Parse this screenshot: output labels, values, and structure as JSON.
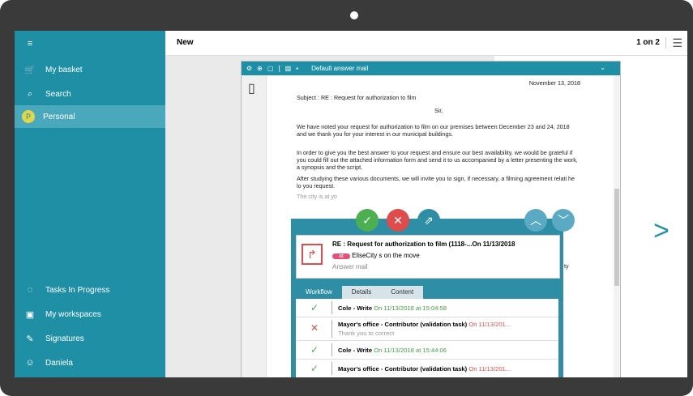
{
  "sidebar": {
    "menu_icon": "hamburger-icon",
    "top_items": [
      {
        "icon": "basket-icon",
        "label": "My basket"
      },
      {
        "icon": "search-icon",
        "label": "Search"
      },
      {
        "icon": "avatar",
        "label": "Personal",
        "avatar_letter": "P"
      }
    ],
    "bottom_items": [
      {
        "icon": "tasks-icon",
        "label": "Tasks In Progress"
      },
      {
        "icon": "workspaces-icon",
        "label": "My workspaces"
      },
      {
        "icon": "signature-icon",
        "label": "Signatures"
      },
      {
        "icon": "user-icon",
        "label": "Daniela"
      }
    ]
  },
  "topbar": {
    "title": "New",
    "pager": "1 on 2"
  },
  "document": {
    "toolbar_title": "Default answer mail",
    "date": "November 13, 2018",
    "subject": "Subject : RE : Request for authorization to film",
    "salutation": "Sir,",
    "p1": "We have noted your request for authorization to film on our premises between December 23 and 24, 2018 and we thank you for your interest in our municipal buildings.",
    "p2": "In order to give you the best answer to your request and ensure our best availability, we would be grateful if you could fill out the attached information form and send it to us accompanied by a letter presenting the work, a synopsis and the script.",
    "p3": "After studying these various documents, we will invite you to sign, if necessary, a filming agreement relati",
    "p3b": "he",
    "p3c": "lo",
    "p3d": "you request.",
    "faded": "The city is at yo",
    "right_fragments": [
      "ll",
      "ty"
    ]
  },
  "popup": {
    "mail_title": "RE : Request for authorization to film (1118-...On 11/13/2018",
    "badge": "at",
    "sender": "EliseCity s on the move",
    "mail_type": "Answer mail",
    "tabs": [
      "Workflow",
      "Details",
      "Content"
    ],
    "rows": [
      {
        "status": "done",
        "actor": "Cole - Write",
        "when": "On 11/13/2018 at 15:04:58",
        "note": ""
      },
      {
        "status": "rejected",
        "actor": "Mayor's office - Contributor (validation task)",
        "when": "On 11/13/201...",
        "note": "Thank you to correct"
      },
      {
        "status": "done",
        "actor": "Cole - Write",
        "when": "On 11/13/2018 at 15:44:06",
        "note": ""
      },
      {
        "status": "done",
        "actor": "Mayor's office - Contributor (validation task)",
        "when": "On 11/13/201...",
        "note": ""
      }
    ]
  },
  "colors": {
    "primary": "#1f8fa6",
    "approve": "#4caf50",
    "reject": "#e04c4c",
    "date_green": "#3f9f3f",
    "date_red": "#e04c4c"
  }
}
